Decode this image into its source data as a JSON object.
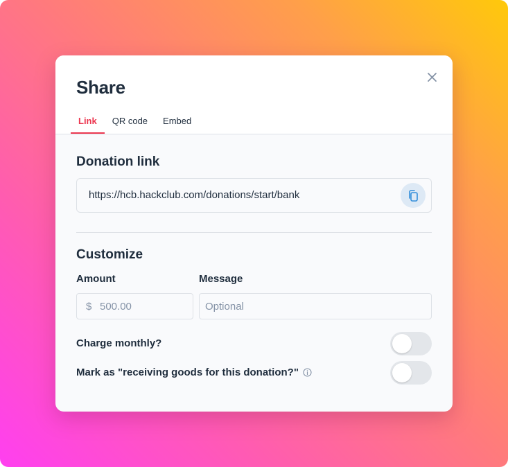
{
  "modal": {
    "title": "Share",
    "close_icon": "close-icon"
  },
  "tabs": [
    {
      "label": "Link",
      "active": true
    },
    {
      "label": "QR code",
      "active": false
    },
    {
      "label": "Embed",
      "active": false
    }
  ],
  "donation_link": {
    "heading": "Donation link",
    "url": "https://hcb.hackclub.com/donations/start/bank",
    "copy_icon": "copy-icon"
  },
  "customize": {
    "heading": "Customize",
    "amount": {
      "label": "Amount",
      "currency_symbol": "$",
      "value": "500.00"
    },
    "message": {
      "label": "Message",
      "placeholder": "Optional",
      "value": ""
    },
    "charge_monthly": {
      "label": "Charge monthly?",
      "enabled": false
    },
    "receiving_goods": {
      "label": "Mark as \"receiving goods for this donation?\"",
      "info_icon": "info-icon",
      "enabled": false
    }
  },
  "colors": {
    "accent": "#ec3750",
    "text": "#1f2d3d",
    "muted": "#8492a6",
    "copy_button_bg": "#dde9f5",
    "toggle_off": "#e3e6ea"
  }
}
